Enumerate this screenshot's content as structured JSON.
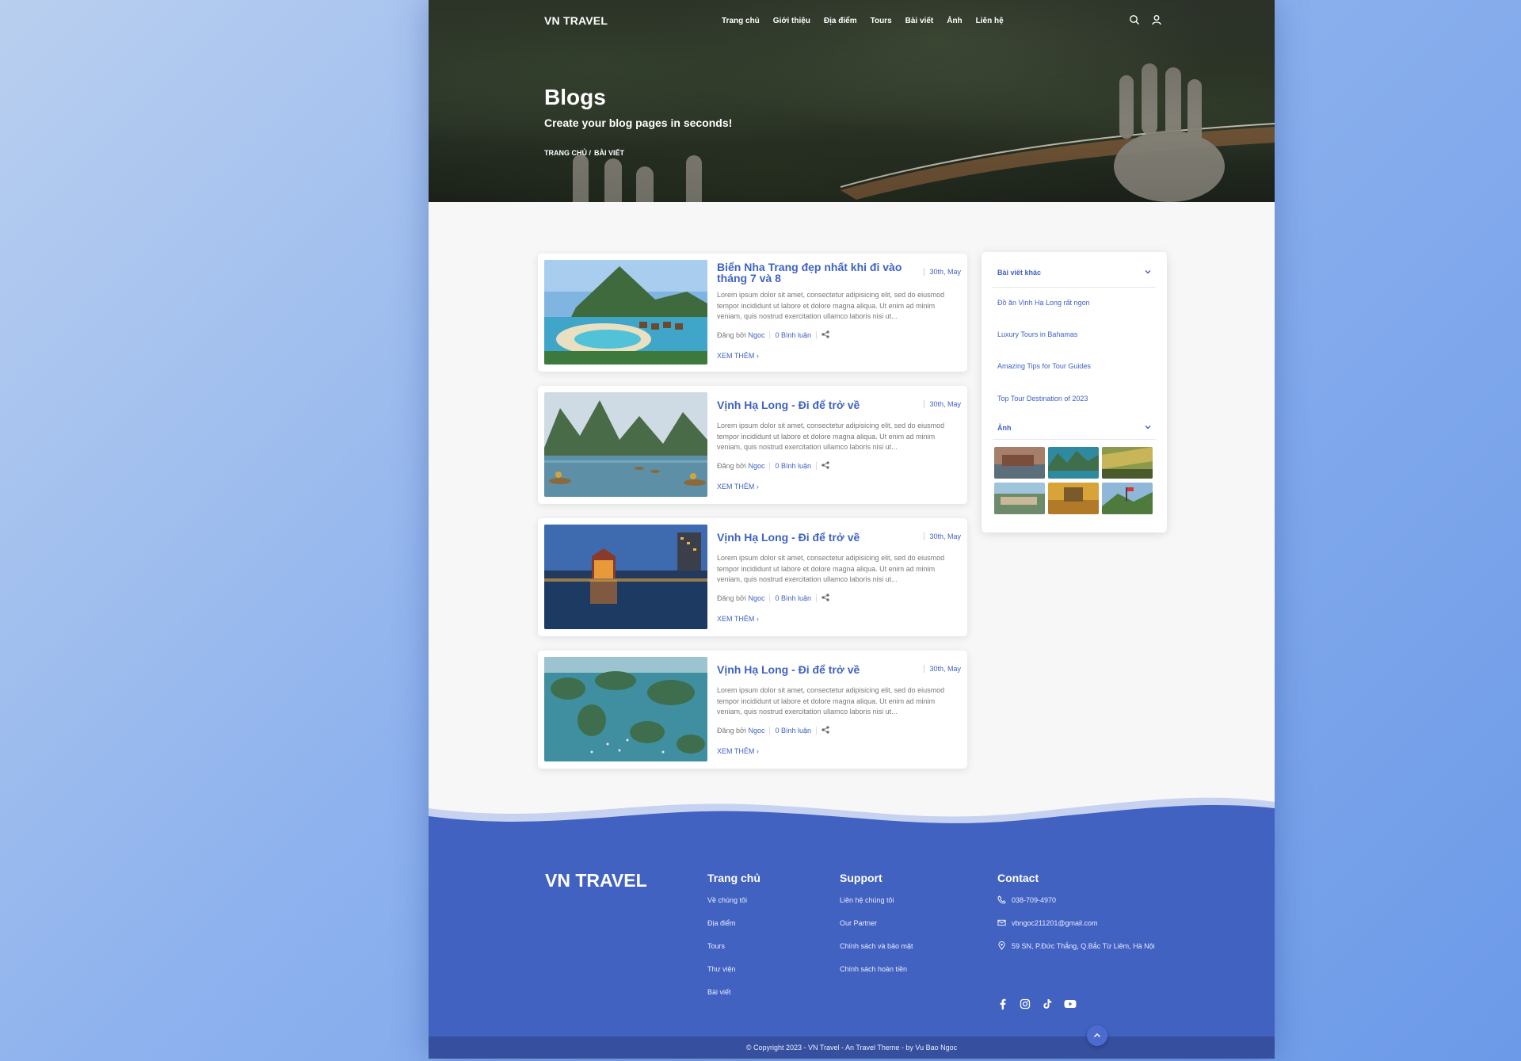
{
  "nav": {
    "logo": "VN TRAVEL",
    "menu": [
      "Trang chủ",
      "Giới thiệu",
      "Địa điểm",
      "Tours",
      "Bài viết",
      "Ảnh",
      "Liên hệ"
    ]
  },
  "hero": {
    "title": "Blogs",
    "subtitle": "Create your blog pages in seconds!",
    "breadcrumb": [
      "TRANG CHỦ /",
      "BÀI VIẾT"
    ]
  },
  "posts": [
    {
      "title": "Biển Nha Trang đẹp nhất khi đi vào tháng 7 và 8",
      "date": "30th, May",
      "excerpt": "Lorem ipsum dolor sit amet, consectetur adipisicing elit, sed do eiusmod tempor incididunt ut labore et dolore magna aliqua. Ut enim ad minim veniam, quis nostrud exercitation ullamco laboris nisi ut...",
      "posted_by": "Đăng bởi",
      "author": "Ngoc",
      "comments": "0 Bình luận",
      "more": "XEM THÊM"
    },
    {
      "title": "Vịnh Hạ Long - Đi để trở về",
      "date": "30th, May",
      "excerpt": "Lorem ipsum dolor sit amet, consectetur adipisicing elit, sed do eiusmod tempor incididunt ut labore et dolore magna aliqua. Ut enim ad minim veniam, quis nostrud exercitation ullamco laboris nisi ut...",
      "posted_by": "Đăng bởi",
      "author": "Ngoc",
      "comments": "0 Bình luận",
      "more": "XEM THÊM"
    },
    {
      "title": "Vịnh Hạ Long - Đi để trở về",
      "date": "30th, May",
      "excerpt": "Lorem ipsum dolor sit amet, consectetur adipisicing elit, sed do eiusmod tempor incididunt ut labore et dolore magna aliqua. Ut enim ad minim veniam, quis nostrud exercitation ullamco laboris nisi ut...",
      "posted_by": "Đăng bởi",
      "author": "Ngoc",
      "comments": "0 Bình luận",
      "more": "XEM THÊM"
    },
    {
      "title": "Vịnh Hạ Long - Đi để trở về",
      "date": "30th, May",
      "excerpt": "Lorem ipsum dolor sit amet, consectetur adipisicing elit, sed do eiusmod tempor incididunt ut labore et dolore magna aliqua. Ut enim ad minim veniam, quis nostrud exercitation ullamco laboris nisi ut...",
      "posted_by": "Đăng bởi",
      "author": "Ngoc",
      "comments": "0 Bình luận",
      "more": "XEM THÊM"
    }
  ],
  "sidebar": {
    "other_posts_heading": "Bài viết khác",
    "other_posts": [
      "Đồ ăn Vịnh Hạ Long rất ngon",
      "Luxury Tours in Bahamas",
      "Amazing Tips for Tour Guides",
      "Top Tour Destination of 2023"
    ],
    "photos_heading": "Ảnh"
  },
  "footer": {
    "logo": "VN TRAVEL",
    "col1": {
      "heading": "Trang chủ",
      "links": [
        "Về chúng tôi",
        "Địa điểm",
        "Tours",
        "Thư viện",
        "Bài viết"
      ]
    },
    "col2": {
      "heading": "Support",
      "links": [
        "Liên hệ chúng tôi",
        "Our Partner",
        "Chính sách và bảo mật",
        "Chính sách hoàn tiền"
      ]
    },
    "col3": {
      "heading": "Contact",
      "phone": "038-709-4970",
      "email": "vbngoc211201@gmail.com",
      "address": "59 SN, P.Đức Thắng, Q.Bắc Từ Liêm, Hà Nội"
    },
    "copyright": "© Copyright 2023 - VN Travel - An Travel Theme - by Vu Bao Ngoc"
  },
  "colors": {
    "accent": "#3f62c4",
    "footer": "#4262c2",
    "copybar": "#36509f"
  }
}
